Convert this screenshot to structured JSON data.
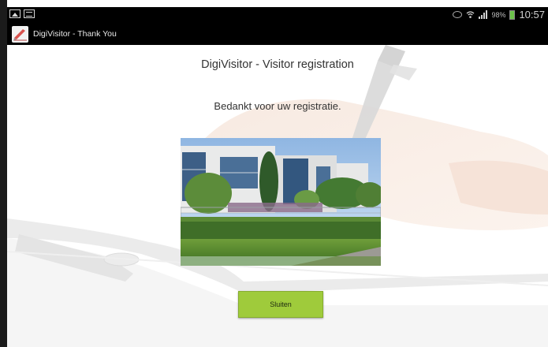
{
  "status_bar": {
    "battery_percent": "98%",
    "time": "10:57",
    "icons": [
      "image-icon",
      "message-icon",
      "eye-icon",
      "wifi-icon",
      "signal-icon",
      "battery-icon"
    ]
  },
  "action_bar": {
    "title": "DigiVisitor - Thank You",
    "app_icon": "digivisitor-logo"
  },
  "main": {
    "heading": "DigiVisitor - Visitor registration",
    "message": "Bedankt voor uw registratie.",
    "close_button": "Sluiten"
  },
  "colors": {
    "button": "#9fcb3b",
    "bars": "#000000",
    "battery": "#6cc24a"
  }
}
